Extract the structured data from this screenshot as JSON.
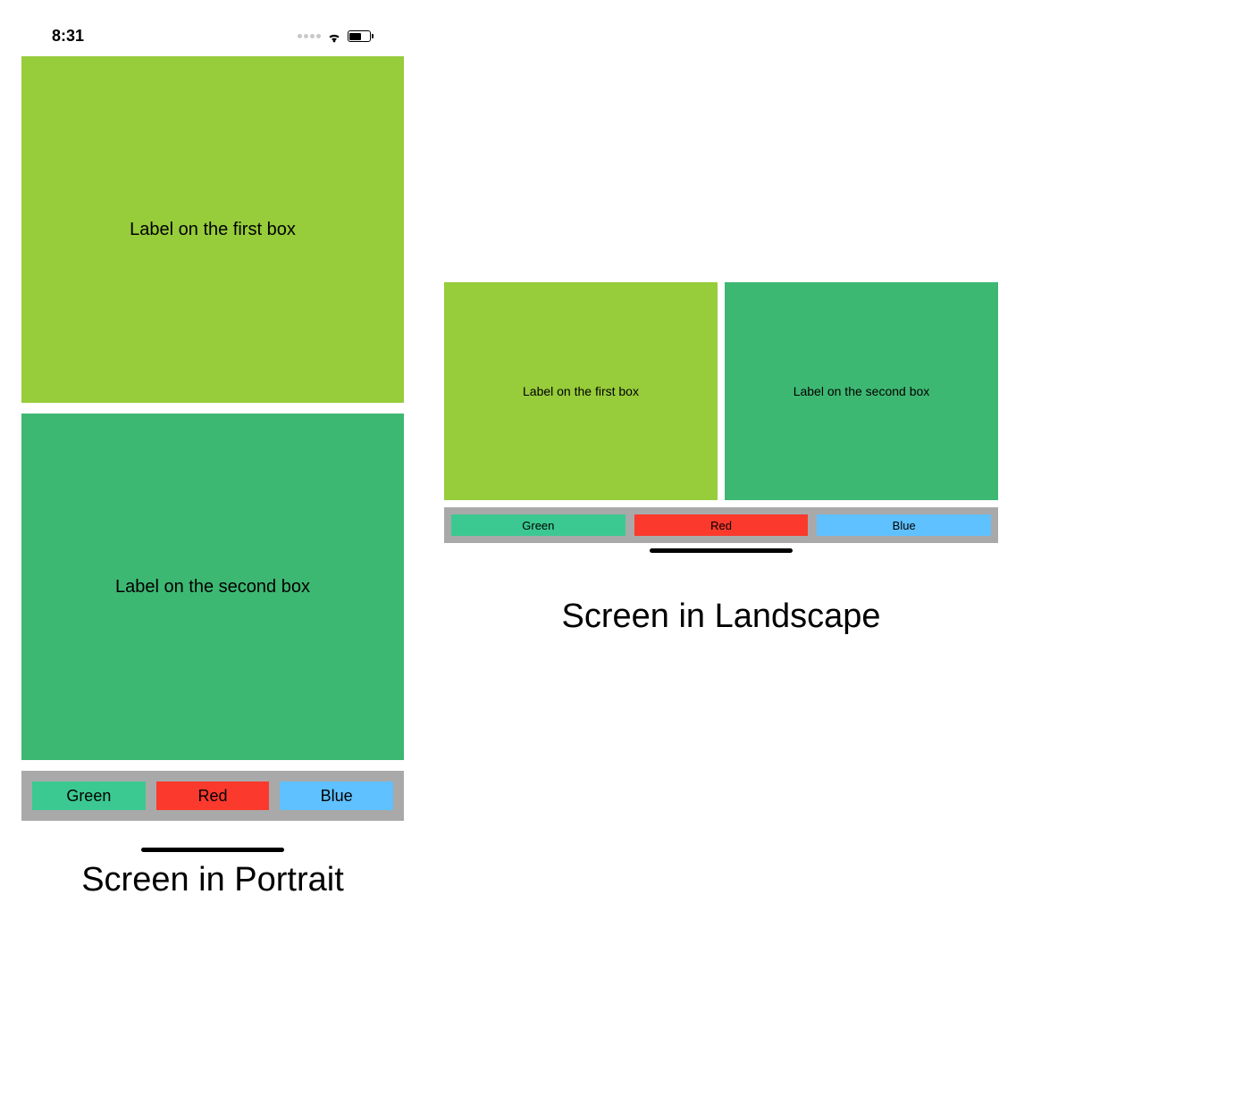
{
  "statusbar": {
    "time": "8:31"
  },
  "colors": {
    "box1": "#97cc3a",
    "box2": "#3db873",
    "toolbar": "#a9a9a9",
    "btn_green": "#3bc991",
    "btn_red": "#fb392d",
    "btn_blue": "#5fc1ff"
  },
  "labels": {
    "box1": "Label on the first box",
    "box2": "Label on the second box"
  },
  "buttons": {
    "green": "Green",
    "red": "Red",
    "blue": "Blue"
  },
  "captions": {
    "portrait": "Screen in Portrait",
    "landscape": "Screen in Landscape"
  }
}
